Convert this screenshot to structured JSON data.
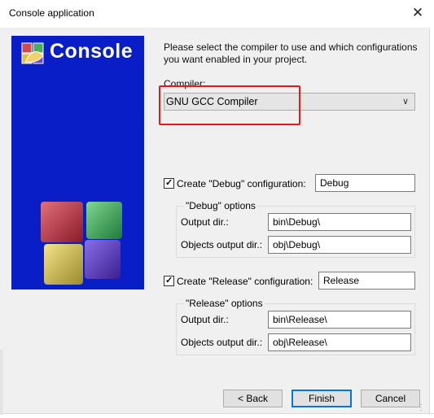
{
  "window": {
    "title": "Console application",
    "close_glyph": "✕"
  },
  "banner": {
    "title": "Console",
    "bg_color": "#0a1ec8",
    "logo_icon": "codeblocks-logo-icon"
  },
  "intro": {
    "line1": "Please select the compiler to use and which configurations",
    "line2": "you want enabled in your project."
  },
  "compiler": {
    "label": "Compiler:",
    "selected": "GNU GCC Compiler",
    "highlight_color": "#e8191a"
  },
  "debug": {
    "checkbox_label": "Create \"Debug\" configuration:",
    "checked": true,
    "name_value": "Debug",
    "group_title": "\"Debug\" options",
    "output_dir_label": "Output dir.:",
    "output_dir_value": "bin\\Debug\\",
    "obj_dir_label": "Objects output dir.:",
    "obj_dir_value": "obj\\Debug\\"
  },
  "release": {
    "checkbox_label": "Create \"Release\" configuration:",
    "checked": true,
    "name_value": "Release",
    "group_title": "\"Release\" options",
    "output_dir_label": "Output dir.:",
    "output_dir_value": "bin\\Release\\",
    "obj_dir_label": "Objects output dir.:",
    "obj_dir_value": "obj\\Release\\"
  },
  "buttons": {
    "back": "< Back",
    "finish": "Finish",
    "cancel": "Cancel"
  },
  "colors": {
    "accent": "#0078d7"
  }
}
